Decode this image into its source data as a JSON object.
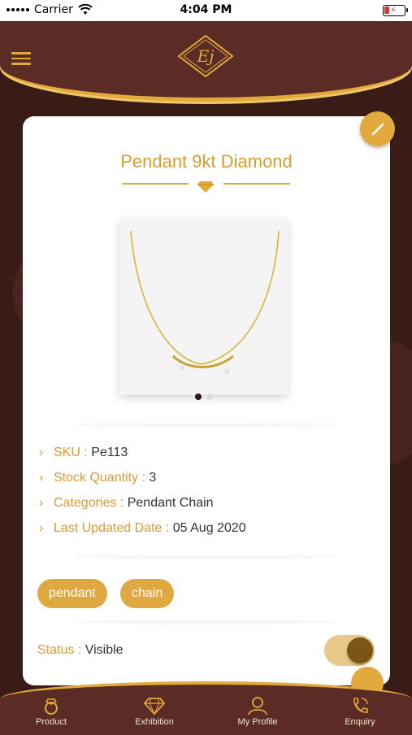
{
  "status_bar": {
    "carrier": "Carrier",
    "time": "4:04 PM"
  },
  "header": {
    "menu_icon": "hamburger-icon",
    "logo_text": "Ej"
  },
  "product": {
    "title": "Pendant 9kt Diamond",
    "image_pages": 2,
    "current_page": 1,
    "details": [
      {
        "label": "SKU :",
        "value": "Pe113"
      },
      {
        "label": "Stock Quantity :",
        "value": "3"
      },
      {
        "label": "Categories :",
        "value": "Pendant Chain"
      },
      {
        "label": "Last Updated Date :",
        "value": "05 Aug 2020"
      }
    ],
    "tags": [
      "pendant",
      "chain"
    ],
    "status_label": "Status :",
    "status_value": "Visible",
    "visible_on": true
  },
  "bottom_nav": [
    {
      "label": "Product",
      "icon": "ring-icon"
    },
    {
      "label": "Exhibition",
      "icon": "diamond-icon"
    },
    {
      "label": "My Profile",
      "icon": "user-icon"
    },
    {
      "label": "Enquiry",
      "icon": "phone-icon"
    }
  ],
  "colors": {
    "gold": "#e2a93d",
    "maroon": "#5b2c25",
    "text_gold": "#d79b34"
  }
}
